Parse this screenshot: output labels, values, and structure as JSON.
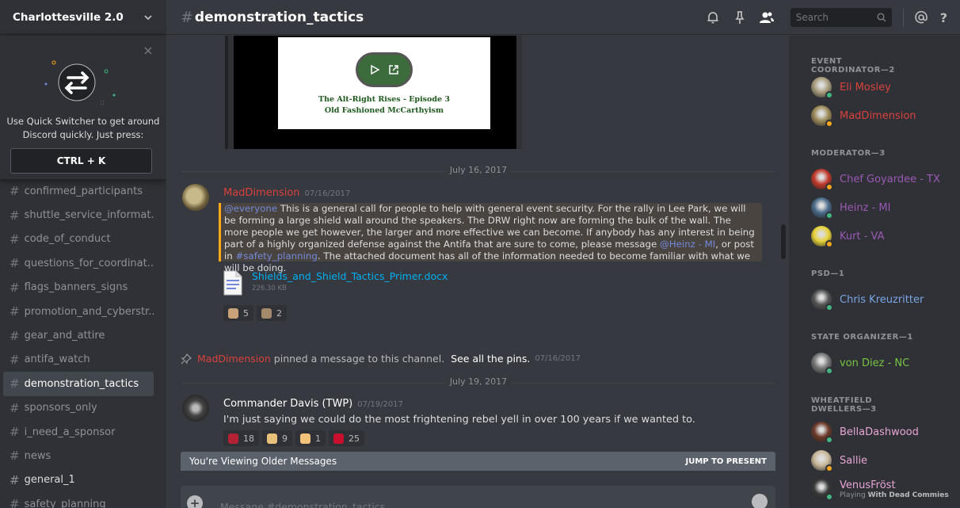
{
  "sidebar": {
    "server_name": "Charlottesville 2.0",
    "switcher": {
      "description": "Use Quick Switcher to get around Discord quickly. Just press:",
      "shortcut": "CTRL + K"
    },
    "channels": [
      {
        "name": "confirmed_participants",
        "state": "muted"
      },
      {
        "name": "shuttle_service_informat...",
        "state": "muted"
      },
      {
        "name": "code_of_conduct",
        "state": "muted"
      },
      {
        "name": "questions_for_coordinat...",
        "state": "muted"
      },
      {
        "name": "flags_banners_signs",
        "state": "muted"
      },
      {
        "name": "promotion_and_cyberstr...",
        "state": "muted"
      },
      {
        "name": "gear_and_attire",
        "state": "muted"
      },
      {
        "name": "antifa_watch",
        "state": "muted"
      },
      {
        "name": "demonstration_tactics",
        "state": "selected"
      },
      {
        "name": "sponsors_only",
        "state": "muted"
      },
      {
        "name": "i_need_a_sponsor",
        "state": "muted"
      },
      {
        "name": "news",
        "state": "muted"
      },
      {
        "name": "general_1",
        "state": "unread"
      },
      {
        "name": "safety_planning",
        "state": "muted"
      }
    ]
  },
  "header": {
    "channel_name": "demonstration_tactics",
    "search_placeholder": "Search",
    "help": "?"
  },
  "messages": {
    "embed": {
      "line1": "The Alt-Right Rises - Episode 3",
      "line2": "Old Fashioned McCarthyism"
    },
    "date1": "July 16, 2017",
    "msg1": {
      "author": "MadDimension",
      "timestamp": "07/16/2017",
      "mention_everyone": "@everyone",
      "text_a": " This is a general call for people to help with general event security. For the rally in Lee Park, we will be forming a large shield wall around the speakers. The DRW right now are forming the bulk of the wall. The more people we get however, the larger and more effective we can become. If anybody has any interest in being part of a highly organized defense against the Antifa that are sure to come, please message ",
      "mention_user": "@Heinz - MI",
      "text_b": ", or post in ",
      "mention_channel": "#safety_planning",
      "text_c": ". The attached document has all of the information needed to become familiar with what we will be doing.",
      "attachment_name": "Shields_and_Shield_Tactics_Primer.docx",
      "attachment_size": "226.30 KB",
      "reactions": [
        {
          "count": "5",
          "color": "#c9a27a"
        },
        {
          "count": "2",
          "color": "#a38a6a"
        }
      ]
    },
    "pin": {
      "who": "MadDimension",
      "text": " pinned a message to this channel. ",
      "link": "See all the pins.",
      "timestamp": "07/16/2017"
    },
    "date2": "July 19, 2017",
    "msg2": {
      "author": "Commander Davis (TWP)",
      "timestamp": "07/19/2017",
      "text": "I'm just saying we could do the most frightening rebel yell in over 100 years if we wanted to.",
      "reactions": [
        {
          "count": "18",
          "color": "#b22234"
        },
        {
          "count": "9",
          "color": "#e8c07a"
        },
        {
          "count": "1",
          "color": "#f2c27a"
        },
        {
          "count": "25",
          "color": "#c8102e"
        }
      ]
    },
    "older_banner": "You're Viewing Older Messages",
    "jump_label": "JUMP TO PRESENT",
    "composer_placeholder": "Message #demonstration_tactics"
  },
  "members": {
    "groups": [
      {
        "header": "EVENT COORDINATOR—2",
        "people": [
          {
            "name": "Eli Mosley",
            "color": "#d9413d",
            "status": "online",
            "avatar": "#a89c7c"
          },
          {
            "name": "MadDimension",
            "color": "#d9413d",
            "status": "idle",
            "avatar": "#9c8a5a"
          }
        ]
      },
      {
        "header": "MODERATOR—3",
        "people": [
          {
            "name": "Chef Goyardee - TX",
            "color": "#9b59b6",
            "status": "idle",
            "avatar": "#c0392b"
          },
          {
            "name": "Heinz - MI",
            "color": "#9b59b6",
            "status": "online",
            "avatar": "#4a6a8a"
          },
          {
            "name": "Kurt - VA",
            "color": "#9b59b6",
            "status": "idle",
            "avatar": "#e8d23a"
          }
        ]
      },
      {
        "header": "PSD—1",
        "people": [
          {
            "name": "Chris Kreuzritter",
            "color": "#7ba5e8",
            "status": "online",
            "avatar": "#555555"
          }
        ]
      },
      {
        "header": "STATE ORGANIZER—1",
        "people": [
          {
            "name": "von Diez - NC",
            "color": "#76c442",
            "status": "online",
            "avatar": "#777777"
          }
        ]
      },
      {
        "header": "WHEATFIELD DWELLERS—3",
        "people": [
          {
            "name": "BellaDashwood",
            "color": "#e8a5d6",
            "status": "online",
            "avatar": "#6b3a2a"
          },
          {
            "name": "Sallie",
            "color": "#e8a5d6",
            "status": "idle",
            "avatar": "#c8b89a"
          },
          {
            "name": "VenusFröst",
            "color": "#e8a5d6",
            "status": "online",
            "avatar": "#3a3a3a",
            "activity_prefix": "Playing ",
            "activity_game": "With Dead Commies"
          }
        ]
      }
    ]
  }
}
